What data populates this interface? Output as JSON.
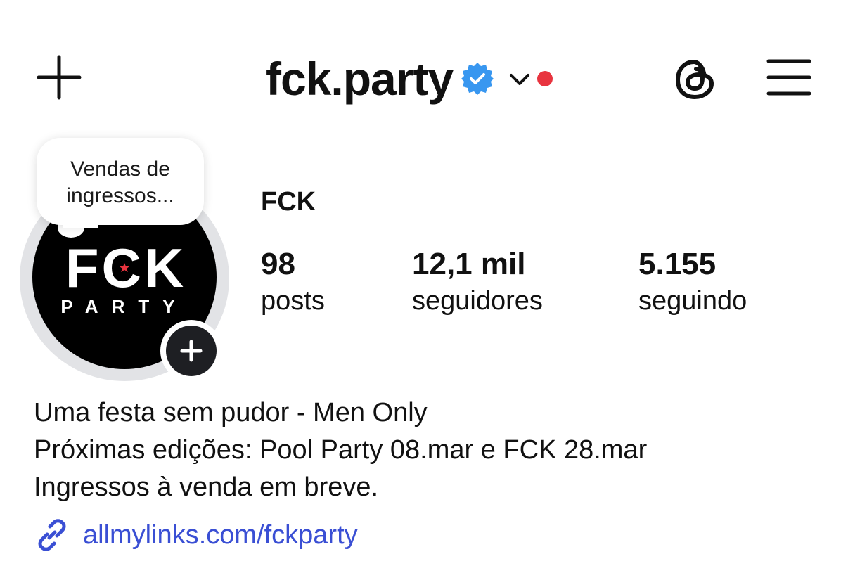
{
  "header": {
    "username": "fck.party",
    "verified_color": "#3897f0",
    "notification_dot_color": "#e8343f"
  },
  "note": {
    "text_line1": "Vendas de",
    "text_line2": "ingressos..."
  },
  "avatar": {
    "logo_top": "FCK",
    "logo_bottom": "PARTY",
    "logo_star_color": "#e8343f"
  },
  "profile": {
    "display_name": "FCK",
    "stats": [
      {
        "value": "98",
        "label": "posts"
      },
      {
        "value": "12,1 mil",
        "label": "seguidores"
      },
      {
        "value": "5.155",
        "label": "seguindo"
      }
    ],
    "bio_lines": [
      "Uma festa sem pudor - Men Only",
      "Próximas edições: Pool Party 08.mar e FCK 28.mar",
      "Ingressos à venda em breve."
    ],
    "link": "allmylinks.com/fckparty",
    "link_color": "#3a4fd4"
  }
}
